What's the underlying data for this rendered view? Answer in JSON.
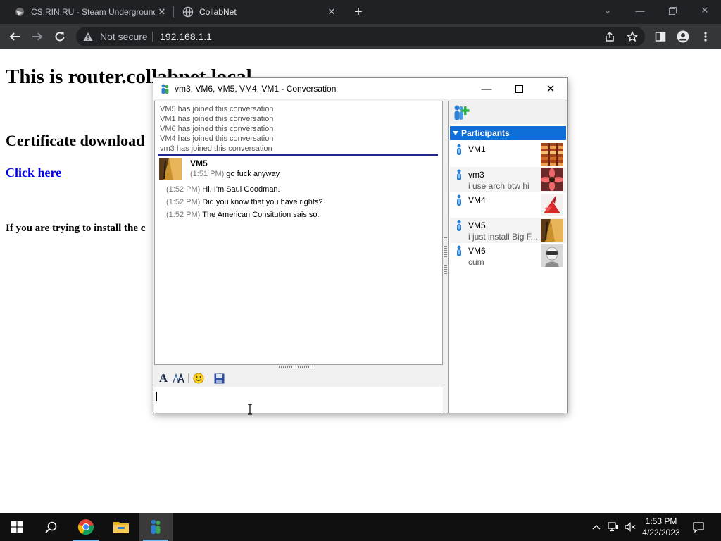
{
  "browser": {
    "tabs": [
      {
        "title": "CS.RIN.RU - Steam Underground",
        "active": false
      },
      {
        "title": "CollabNet",
        "active": true
      }
    ],
    "security_label": "Not secure",
    "url": "192.168.1.1"
  },
  "page": {
    "heading": "This is router.collabnet.local",
    "subheading": "Certificate download",
    "link": "Click here",
    "note": "If you are trying to install the c"
  },
  "conversation": {
    "title": "vm3, VM6, VM5, VM4, VM1 - Conversation",
    "system_messages": [
      "VM5 has joined this conversation",
      "VM1 has joined this conversation",
      "VM6 has joined this conversation",
      "VM4 has joined this conversation",
      "vm3 has joined this conversation"
    ],
    "sender": "VM5",
    "messages": [
      {
        "time": "(1:51 PM)",
        "text": "go fuck anyway"
      },
      {
        "time": "(1:52 PM)",
        "text": "Hi, I'm Saul Goodman."
      },
      {
        "time": "(1:52 PM)",
        "text": "Did you know that you have rights?"
      },
      {
        "time": "(1:52 PM)",
        "text": "The American Consitution sais so."
      }
    ],
    "participants_header": "Participants",
    "participants": [
      {
        "name": "VM1",
        "status": ""
      },
      {
        "name": "vm3",
        "status": "i use arch btw hi"
      },
      {
        "name": "VM4",
        "status": ""
      },
      {
        "name": "VM5",
        "status": "i just install Big F..."
      },
      {
        "name": "VM6",
        "status": "cum"
      }
    ]
  },
  "taskbar": {
    "time": "1:53 PM",
    "date": "4/22/2023"
  }
}
